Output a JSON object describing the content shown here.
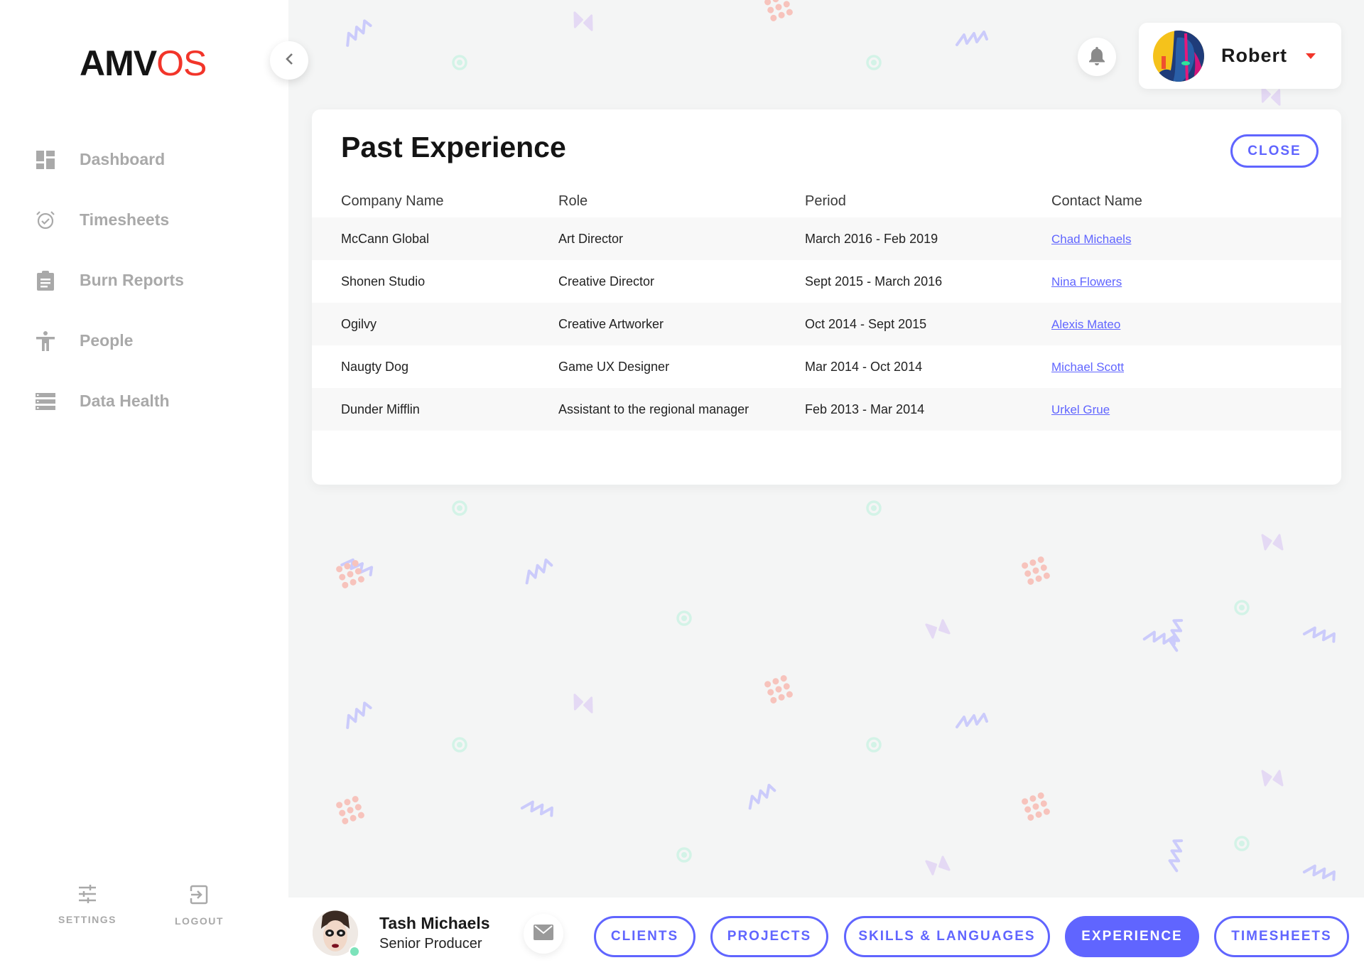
{
  "app": {
    "logo_primary": "AMV",
    "logo_accent": "OS",
    "accent_color": "#6065ff",
    "brand_red": "#f2352a"
  },
  "sidebar": {
    "items": [
      {
        "label": "Dashboard",
        "icon": "dashboard-icon"
      },
      {
        "label": "Timesheets",
        "icon": "alarm-clock-icon"
      },
      {
        "label": "Burn Reports",
        "icon": "clipboard-icon"
      },
      {
        "label": "People",
        "icon": "person-icon"
      },
      {
        "label": "Data Health",
        "icon": "server-icon"
      }
    ],
    "settings_label": "SETTINGS",
    "logout_label": "LOGOUT"
  },
  "header": {
    "user_name": "Robert"
  },
  "experience": {
    "title": "Past Experience",
    "close_label": "CLOSE",
    "columns": [
      "Company Name",
      "Role",
      "Period",
      "Contact Name"
    ],
    "rows": [
      {
        "company": "McCann Global",
        "role": "Art Director",
        "period": "March 2016 - Feb 2019",
        "contact": "Chad Michaels"
      },
      {
        "company": "Shonen Studio",
        "role": "Creative Director",
        "period": "Sept 2015 - March 2016",
        "contact": "Nina Flowers"
      },
      {
        "company": "Ogilvy",
        "role": "Creative Artworker",
        "period": "Oct 2014 - Sept 2015",
        "contact": "Alexis Mateo"
      },
      {
        "company": "Naugty Dog",
        "role": "Game UX Designer",
        "period": "Mar 2014 - Oct 2014",
        "contact": "Michael Scott"
      },
      {
        "company": "Dunder Mifflin",
        "role": "Assistant to the regional manager",
        "period": "Feb 2013 - Mar 2014",
        "contact": "Urkel Grue"
      }
    ]
  },
  "profile": {
    "name": "Tash Michaels",
    "title": "Senior Producer",
    "status": "online"
  },
  "tabs": [
    {
      "label": "CLIENTS",
      "active": false
    },
    {
      "label": "PROJECTS",
      "active": false
    },
    {
      "label": "SKILLS & LANGUAGES",
      "active": false
    },
    {
      "label": "EXPERIENCE",
      "active": true
    },
    {
      "label": "TIMESHEETS",
      "active": false
    }
  ]
}
